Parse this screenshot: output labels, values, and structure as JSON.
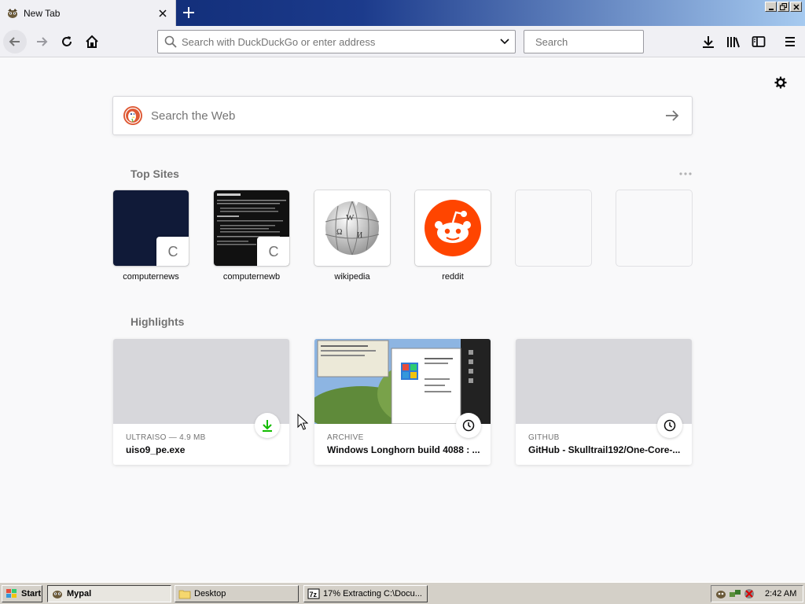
{
  "tab": {
    "title": "New Tab"
  },
  "toolbar": {
    "url_placeholder": "Search with DuckDuckGo or enter address",
    "search_placeholder": "Search"
  },
  "page": {
    "websearch_placeholder": "Search the Web",
    "topsites_title": "Top Sites",
    "highlights_title": "Highlights"
  },
  "topsites": [
    {
      "label": "computernews",
      "letter": "C"
    },
    {
      "label": "computernewb",
      "letter": "C"
    },
    {
      "label": "wikipedia",
      "letter": ""
    },
    {
      "label": "reddit",
      "letter": ""
    }
  ],
  "highlights": [
    {
      "context": "ULTRAISO — 4.9 MB",
      "title": "uiso9_pe.exe",
      "badge": "download-icon"
    },
    {
      "context": "ARCHIVE",
      "title": "Windows Longhorn build 4088 : ...",
      "badge": "clock-icon"
    },
    {
      "context": "GITHUB",
      "title": "GitHub - Skulltrail192/One-Core-...",
      "badge": "clock-icon"
    }
  ],
  "taskbar": {
    "start": "Start",
    "tasks": [
      "Mypal",
      "Desktop",
      "17% Extracting C:\\Docu..."
    ],
    "clock": "2:42 AM"
  },
  "colors": {
    "titlebar": "#0a246a",
    "reddit": "#ff4500",
    "duckduckgo": "#de5833",
    "download_green": "#12bc00"
  }
}
